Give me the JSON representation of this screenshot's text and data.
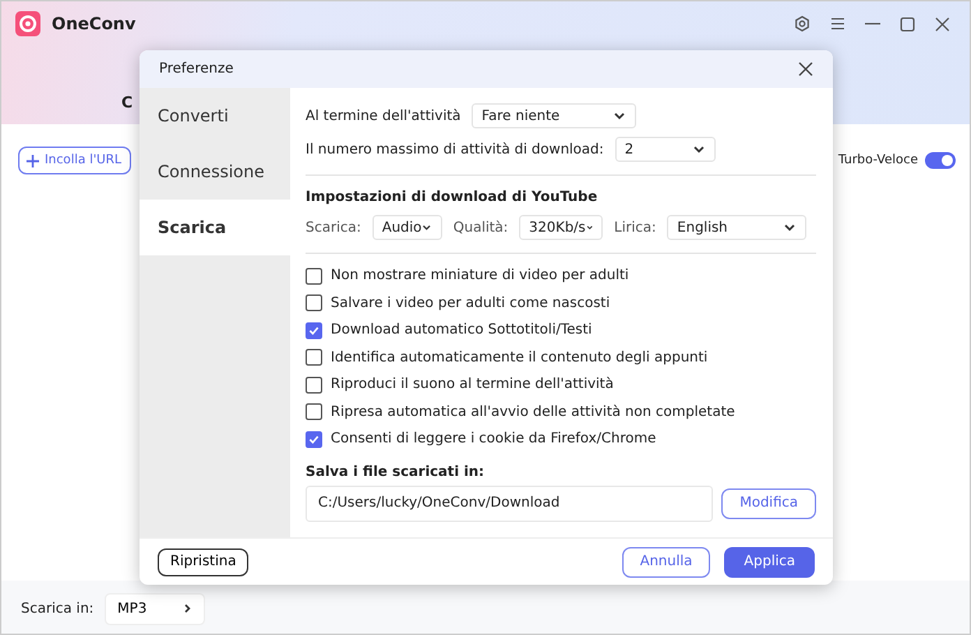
{
  "app": {
    "title": "OneConv",
    "partial_tab": "C",
    "paste_button": "Incolla l'URL",
    "turbo": {
      "label": "Turbo-Veloce",
      "on": true
    },
    "bottom": {
      "label": "Scarica in:",
      "format": "MP3"
    }
  },
  "dialog": {
    "title": "Preferenze",
    "sidebar": [
      {
        "label": "Converti",
        "selected": false
      },
      {
        "label": "Connessione",
        "selected": false
      },
      {
        "label": "Scarica",
        "selected": true
      }
    ],
    "end_action": {
      "label": "Al termine dell'attività",
      "value": "Fare niente"
    },
    "max_tasks": {
      "label": "Il numero massimo di attività di download:",
      "value": "2"
    },
    "youtube": {
      "heading": "Impostazioni di download di YouTube",
      "fields": [
        {
          "label": "Scarica:",
          "value": "Audio"
        },
        {
          "label": "Qualità:",
          "value": "320Kb/s"
        },
        {
          "label": "Lirica:",
          "value": "English"
        }
      ]
    },
    "options": [
      {
        "label": "Non mostrare miniature di video per adulti",
        "checked": false
      },
      {
        "label": "Salvare i video per adulti come nascosti",
        "checked": false
      },
      {
        "label": "Download automatico Sottotitoli/Testi",
        "checked": true
      },
      {
        "label": "Identifica automaticamente il contenuto degli appunti",
        "checked": false
      },
      {
        "label": "Riproduci il suono al termine dell'attività",
        "checked": false
      },
      {
        "label": "Ripresa automatica all'avvio delle attività non completate",
        "checked": false
      },
      {
        "label": "Consenti di leggere i cookie da Firefox/Chrome",
        "checked": true
      }
    ],
    "save": {
      "heading": "Salva i file scaricati in:",
      "path": "C:/Users/lucky/OneConv/Download",
      "button": "Modifica"
    },
    "buttons": {
      "reset": "Ripristina",
      "cancel": "Annulla",
      "apply": "Applica"
    }
  }
}
